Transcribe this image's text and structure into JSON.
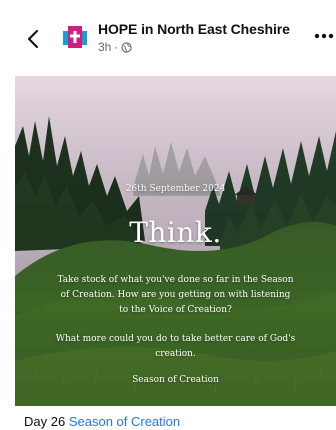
{
  "header": {
    "page_name": "HOPE in North East Cheshire",
    "time_ago": "3h",
    "separator": "·",
    "back_icon": "chevron-left-icon",
    "audience_icon": "globe-icon",
    "more_icon": "more-horizontal-icon"
  },
  "post_image": {
    "date": "26th September 2024",
    "headline": "Think.",
    "paragraph1": "Take stock of what you've done so far in the Season of Creation. How are you getting on with listening to the Voice of Creation?",
    "paragraph2": "What more could you do to take better care of God's creation.",
    "signature": "Season of Creation"
  },
  "caption": {
    "prefix": "Day 26",
    "link": "Season of Creation"
  },
  "colors": {
    "link": "#1877f2",
    "logo_blue": "#1d9bd7",
    "logo_magenta": "#d01f7a"
  }
}
